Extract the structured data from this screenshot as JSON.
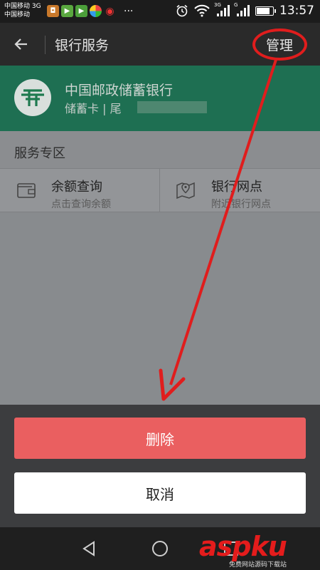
{
  "status_bar": {
    "carrier_1": "中国移动 3G",
    "carrier_2": "中国移动",
    "app_icons": [
      "app-a-icon",
      "video-player-icon",
      "video-player-icon",
      "color-app-icon",
      "weibo-icon"
    ],
    "more": "···",
    "signal_1_label": "3G",
    "signal_2_label": "G",
    "battery_level": 0.85,
    "time": "13:57"
  },
  "header": {
    "back_icon": "arrow-left-icon",
    "title": "银行服务",
    "manage_label": "管理"
  },
  "card": {
    "bank_name": "中国邮政储蓄银行",
    "card_info": "储蓄卡 | 尾"
  },
  "services": {
    "section_title": "服务专区",
    "items": [
      {
        "icon": "wallet-icon",
        "title": "余额查询",
        "subtitle": "点击查询余额"
      },
      {
        "icon": "map-pin-icon",
        "title": "银行网点",
        "subtitle": "附近银行网点"
      }
    ]
  },
  "sheet": {
    "delete_label": "删除",
    "cancel_label": "取消"
  },
  "navbar": {
    "icons": [
      "back-triangle-icon",
      "home-circle-icon",
      "recents-square-icon"
    ]
  },
  "watermark": {
    "brand": "aspku",
    "sub": "免费网站源码下载站"
  },
  "colors": {
    "card_green": "#1e6f52",
    "delete_red": "#ea5f60",
    "annotation_red": "#e01d1d"
  }
}
